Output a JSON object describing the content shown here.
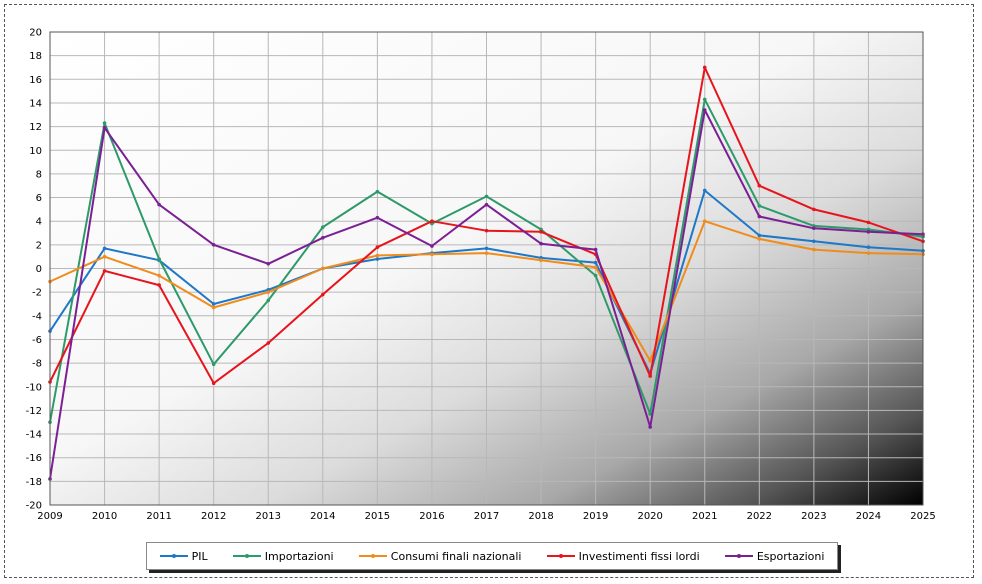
{
  "chart_data": {
    "type": "line",
    "x": [
      "2009",
      "2010",
      "2011",
      "2012",
      "2013",
      "2014",
      "2015",
      "2016",
      "2017",
      "2018",
      "2019",
      "2020",
      "2021",
      "2022",
      "2023",
      "2024",
      "2025"
    ],
    "ylim": [
      -20,
      20
    ],
    "yticks": [
      20,
      18,
      16,
      14,
      12,
      10,
      8,
      6,
      4,
      2,
      0,
      -2,
      -4,
      -6,
      -8,
      -10,
      -12,
      -14,
      -16,
      -18,
      -20
    ],
    "grid": true,
    "legend_position": "bottom",
    "series": [
      {
        "name": "PIL",
        "color": "#1f77c8",
        "values": [
          -5.3,
          1.7,
          0.7,
          -3.0,
          -1.8,
          0.0,
          0.8,
          1.3,
          1.7,
          0.9,
          0.5,
          -8.9,
          6.6,
          2.8,
          2.3,
          1.8,
          1.5
        ]
      },
      {
        "name": "Importazioni",
        "color": "#2e9a6a",
        "values": [
          -13.0,
          12.3,
          0.8,
          -8.1,
          -2.7,
          3.5,
          6.5,
          3.8,
          6.1,
          3.3,
          -0.6,
          -12.3,
          14.3,
          5.3,
          3.6,
          3.3,
          2.7
        ]
      },
      {
        "name": "Consumi finali nazionali",
        "color": "#f08c1c",
        "values": [
          -1.1,
          1.0,
          -0.6,
          -3.3,
          -2.0,
          0.0,
          1.1,
          1.2,
          1.3,
          0.7,
          0.1,
          -7.8,
          4.0,
          2.5,
          1.6,
          1.3,
          1.2
        ]
      },
      {
        "name": "Investimenti fissi lordi",
        "color": "#e8141c",
        "values": [
          -9.6,
          -0.2,
          -1.4,
          -9.7,
          -6.3,
          -2.2,
          1.8,
          4.0,
          3.2,
          3.1,
          1.2,
          -9.1,
          17.0,
          7.0,
          5.0,
          3.9,
          2.3
        ]
      },
      {
        "name": "Esportazioni",
        "color": "#7b1f94",
        "values": [
          -17.8,
          11.9,
          5.4,
          2.0,
          0.4,
          2.6,
          4.3,
          1.9,
          5.4,
          2.1,
          1.6,
          -13.4,
          13.4,
          4.4,
          3.4,
          3.1,
          2.9
        ]
      }
    ]
  }
}
